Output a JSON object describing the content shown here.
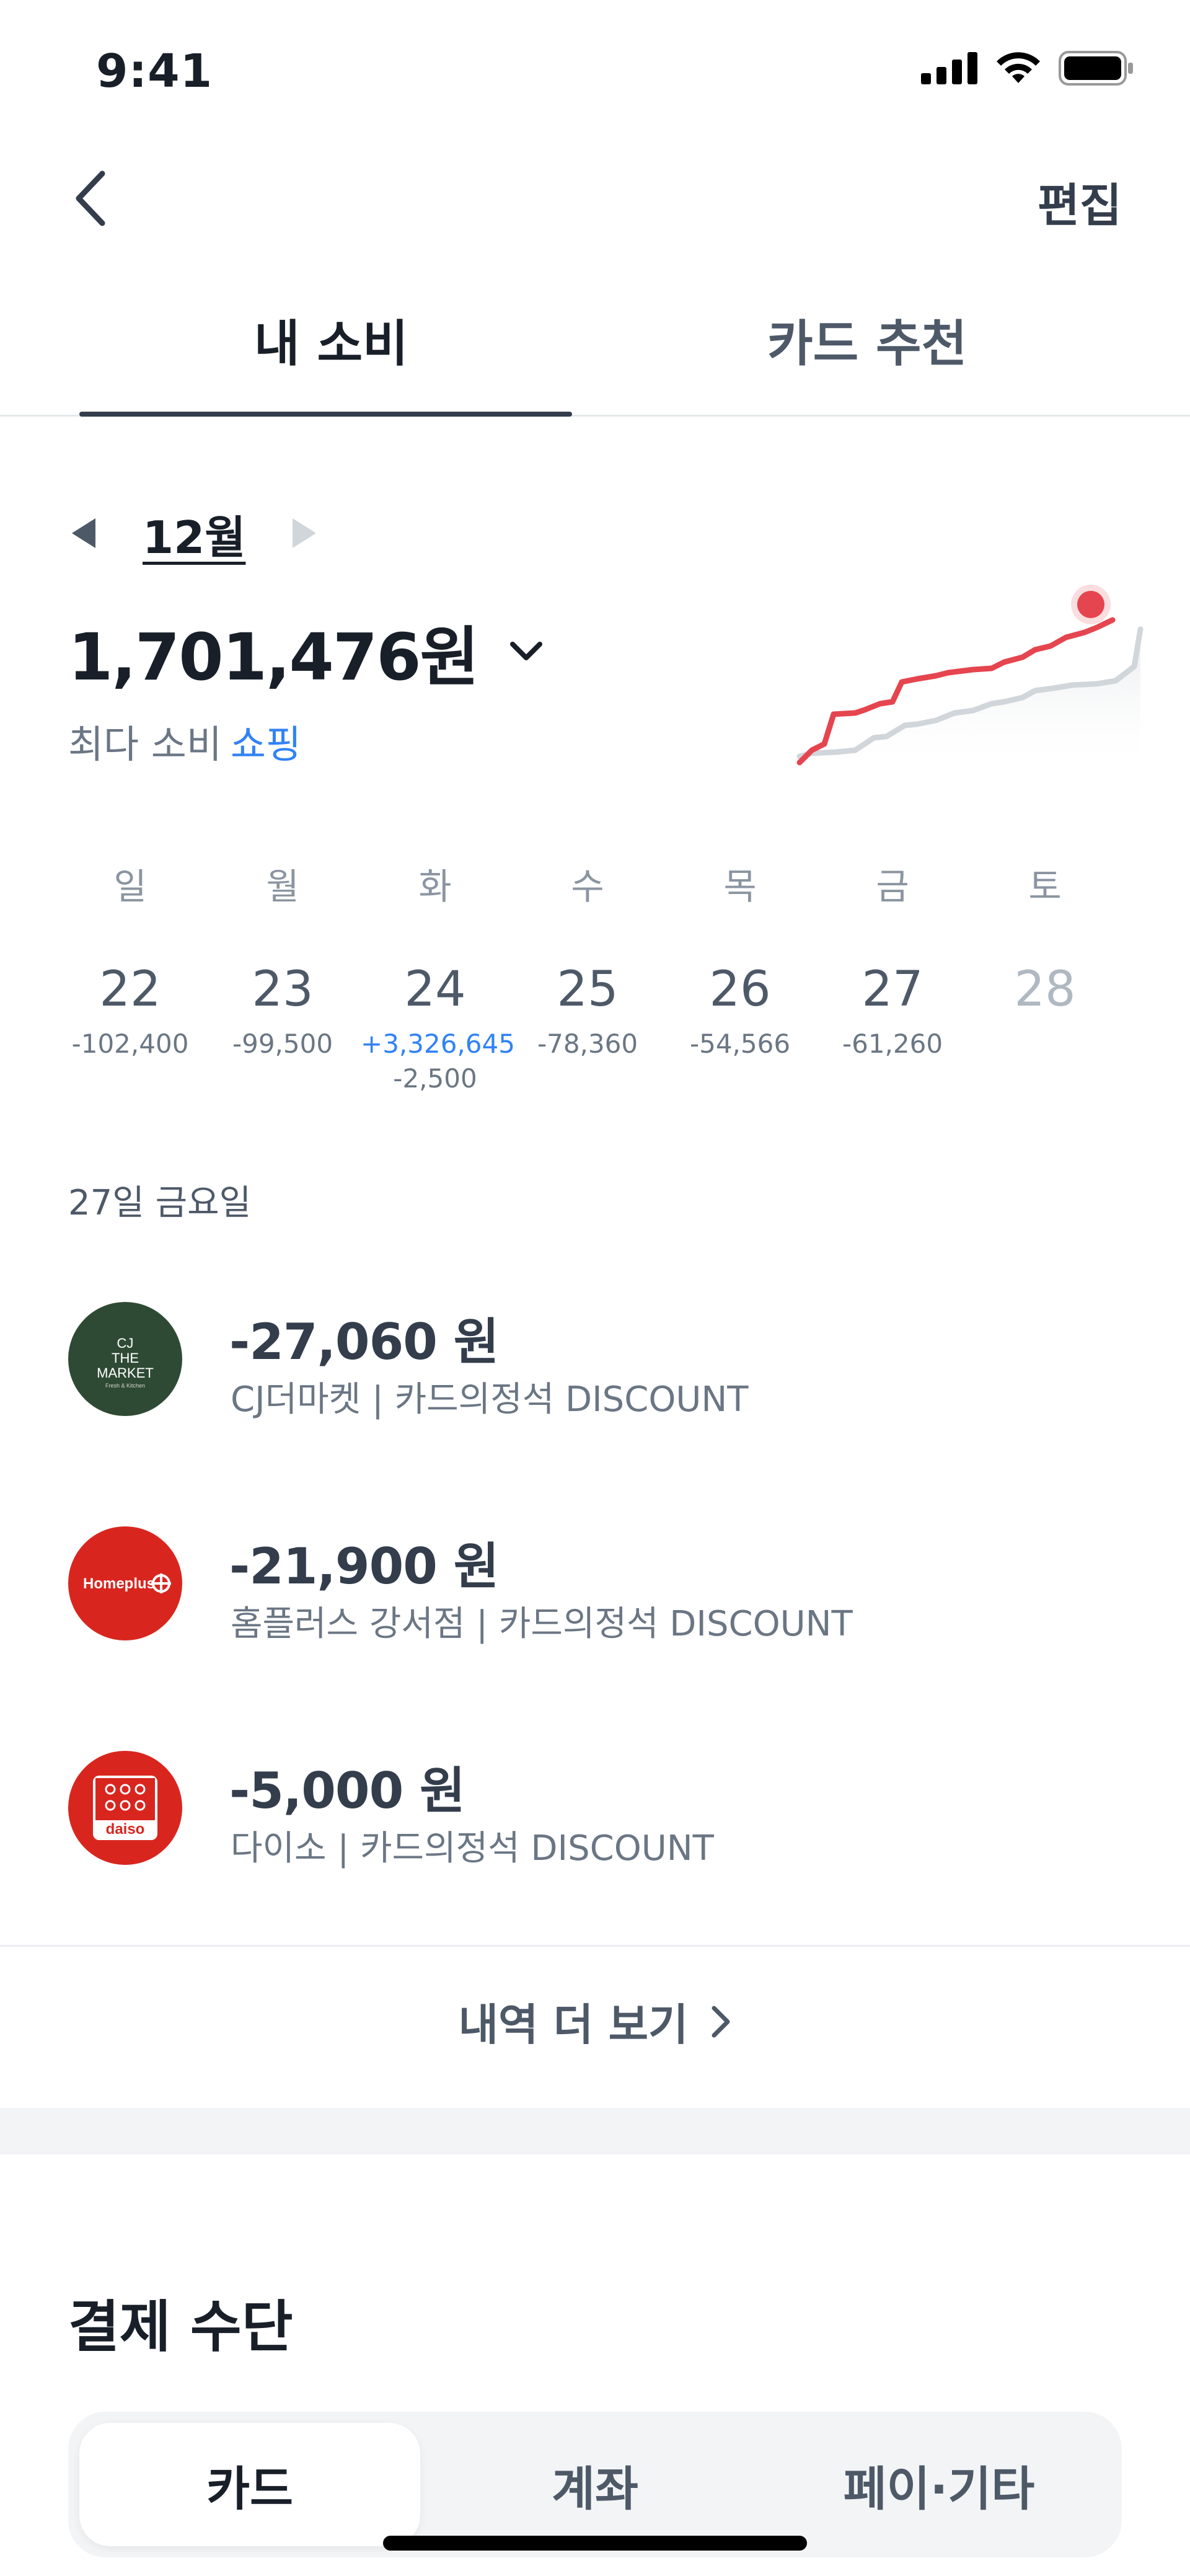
{
  "status_bar": {
    "time": "9:41"
  },
  "header": {
    "edit_label": "편집"
  },
  "tabs": [
    {
      "label": "내 소비",
      "active": true
    },
    {
      "label": "카드 추천",
      "active": false
    }
  ],
  "summary": {
    "month": "12월",
    "total": "1,701,476원",
    "most_spent_prefix": "최다 소비",
    "most_spent_category": "쇼핑"
  },
  "week": [
    {
      "day": "일",
      "date": "22",
      "amounts": [
        "-102,400"
      ]
    },
    {
      "day": "월",
      "date": "23",
      "amounts": [
        "-99,500"
      ]
    },
    {
      "day": "화",
      "date": "24",
      "income": "+3,326,645",
      "amounts": [
        "-2,500"
      ]
    },
    {
      "day": "수",
      "date": "25",
      "amounts": [
        "-78,360"
      ]
    },
    {
      "day": "목",
      "date": "26",
      "amounts": [
        "-54,566"
      ]
    },
    {
      "day": "금",
      "date": "27",
      "amounts": [
        "-61,260"
      ],
      "selected": true
    },
    {
      "day": "토",
      "date": "28",
      "amounts": [],
      "future": true
    }
  ],
  "selected_date_label": "27일 금요일",
  "transactions": [
    {
      "amount": "-27,060 원",
      "description": "CJ더마켓 | 카드의정석 DISCOUNT",
      "logo_icon": "cj-the-market-logo",
      "logo_color": "#2f4a34",
      "logo_text": [
        "CJ",
        "THE",
        "MARKET",
        "Fresh & Kitchen"
      ]
    },
    {
      "amount": "-21,900 원",
      "description": "홈플러스 강서점 | 카드의정석 DISCOUNT",
      "logo_icon": "homeplus-logo",
      "logo_color": "#d8261f",
      "logo_text": [
        "Homeplus"
      ]
    },
    {
      "amount": "-5,000 원",
      "description": "다이소 | 카드의정석 DISCOUNT",
      "logo_icon": "daiso-logo",
      "logo_color": "#d8261f",
      "logo_text": [
        "daiso"
      ]
    }
  ],
  "more_label": "내역 더 보기",
  "payment": {
    "title": "결제 수단",
    "segments": [
      {
        "label": "카드",
        "active": true
      },
      {
        "label": "계좌",
        "active": false
      },
      {
        "label": "페이·기타",
        "active": false
      }
    ]
  },
  "colors": {
    "accent_blue": "#3182f6",
    "trend_current": "#e5454f",
    "trend_previous": "#d1d6db"
  }
}
